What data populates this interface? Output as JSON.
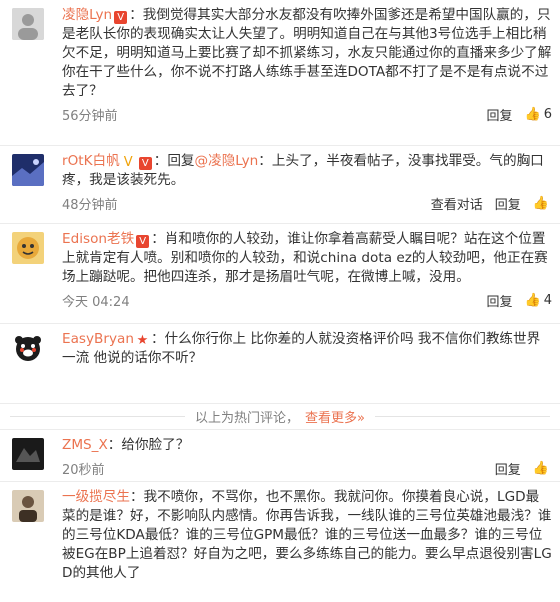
{
  "comments": [
    {
      "name": "凌隐Lyn",
      "badges": "V",
      "text_lines": "：我倒觉得其实大部分水友都没有吹捧外国爹还是希望中国队赢的，只是老队长你的表现确实太让人失望了。明明知道自己在与其他3号位选手上相比稍欠不足，明明知道马上要比赛了却不抓紧练习，水友只能通过你的直播来多少了解你在干了些什么，你不说不打路人练练手甚至连DOTA都不打了是不是有点说不过去了？",
      "time": "56分钟前",
      "reply_label": "回复",
      "likes": "6",
      "avatar_color": "#cfcfcf"
    },
    {
      "name": "rOtK白帆",
      "badges": "VV",
      "mention": "@凌隐Lyn",
      "text": "：上头了，半夜看帖子，没事找罪受。气的胸口疼，我是该装死先。",
      "reply_prefix": "：回复",
      "time": "48分钟前",
      "view_convo_label": "查看对话",
      "reply_label": "回复",
      "likes": "",
      "avatar_color": "#3a4a8a"
    },
    {
      "name": "Edison老铁",
      "badges": "V",
      "text": "：肖和喷你的人较劲，谁让你拿着高薪受人瞩目呢？站在这个位置上就肯定有人喷。别和喷你的人较劲，和说china dota ez的人较劲吧，他正在赛场上蹦跶呢。把他四连杀，那才是扬眉吐气呢，在微博上喊，没用。",
      "time": "今天 04:24",
      "reply_label": "回复",
      "likes": "4",
      "avatar_color": "#e7b84a"
    },
    {
      "name": "EasyBryan",
      "badges": "★",
      "text": "：什么你行你上 比你差的人就没资格评价吗 我不信你们教练世界一流 他说的话你不听？",
      "avatar_color": "#1c1c1c"
    }
  ],
  "hot_bar": {
    "text": "以上为热门评论，",
    "more_label": "查看更多»"
  },
  "recent": [
    {
      "name": "ZMS_X",
      "text": "：给你脸了？",
      "time": "20秒前",
      "reply_label": "回复",
      "avatar_color": "#2a2a2a"
    },
    {
      "name": "一级揽尽生",
      "text": "：我不喷你，不骂你，也不黑你。我就问你。你摸着良心说，LGD最菜的是谁？好，不影响队内感情。你再告诉我，一线队谁的三号位英雄池最浅？谁的三号位KDA最低？谁的三号位GPM最低？谁的三号位送一血最多？谁的三号位被EG在BP上追着怼？好自为之吧，要么多练练自己的能力。要么早点退役别害LGD的其他人了",
      "avatar_color": "#5a4a3a"
    }
  ],
  "colors": {
    "accent": "#eb7350",
    "muted": "#808080"
  }
}
